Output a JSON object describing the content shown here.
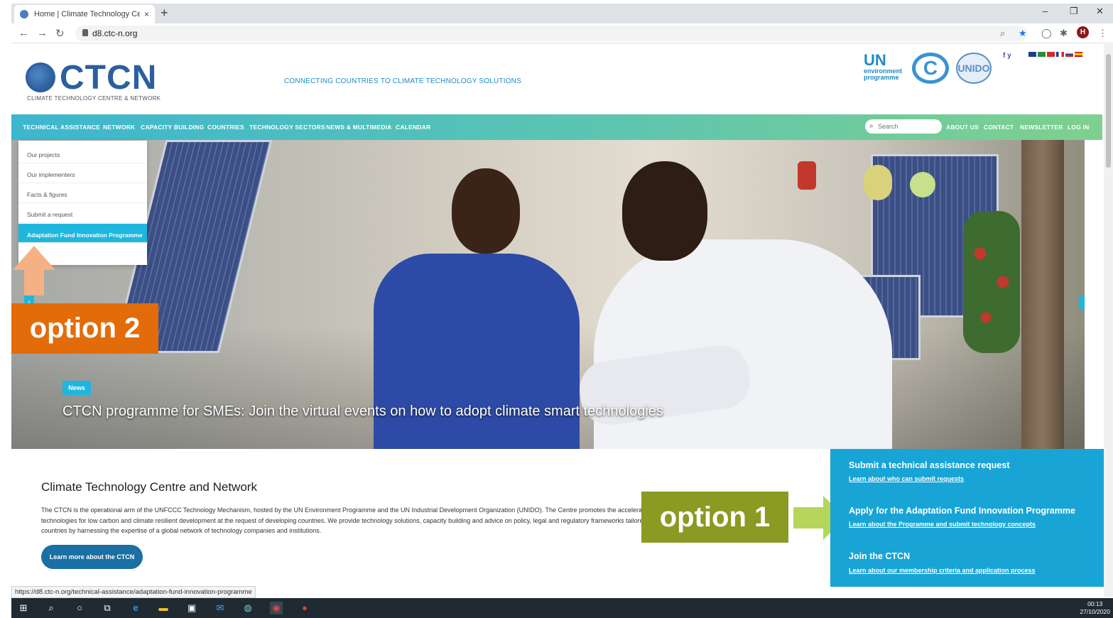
{
  "browser": {
    "tab_title": "Home | Climate Technology Cent",
    "tab_close": "×",
    "new_tab": "+",
    "url": "d8.ctc-n.org",
    "win_minimize": "–",
    "win_restore": "❐",
    "win_close": "✕",
    "avatar_letter": "H",
    "status_url": "https://d8.ctc-n.org/technical-assistance/adaptation-fund-innovation-programme"
  },
  "header": {
    "logo_text": "CTCN",
    "logo_subtitle": "CLIMATE TECHNOLOGY CENTRE & NETWORK",
    "tagline": "CONNECTING COUNTRIES TO CLIMATE TECHNOLOGY SOLUTIONS",
    "partner_un": "UN",
    "partner_un_sub1": "environment",
    "partner_un_sub2": "programme",
    "partner_unfccc": "C",
    "partner_unido": "UNIDO",
    "social": "f  y"
  },
  "nav": {
    "items": [
      "TECHNICAL ASSISTANCE",
      "NETWORK",
      "CAPACITY BUILDING",
      "COUNTRIES",
      "TECHNOLOGY SECTORS",
      "NEWS & MULTIMEDIA",
      "CALENDAR"
    ],
    "search_placeholder": "Search",
    "right_items": [
      "ABOUT US",
      "CONTACT",
      "NEWSLETTER",
      "LOG IN"
    ]
  },
  "dropdown": {
    "items": [
      "Our projects",
      "Our implementers",
      "Facts & figures",
      "Submit a request",
      "Adaptation Fund Innovation Programme"
    ]
  },
  "hero": {
    "badge": "News",
    "caption": "CTCN programme for SMEs: Join the virtual events on how to adopt climate smart technologies",
    "next": "›",
    "prev": "‹"
  },
  "annotations": {
    "option1": "option 1",
    "option2": "option 2"
  },
  "about": {
    "title": "Climate Technology Centre and Network",
    "line1": "The CTCN is the operational arm of the UNFCCC Technology Mechanism, hosted by the UN Environment Programme and the UN Industrial Development Organization (UNIDO). The Centre promotes the accelerated transfer of environmentally sound",
    "line2": "technologies for low carbon and climate resilient development at the request of developing countries. We provide technology solutions, capacity building and advice on policy, legal and regulatory frameworks tailored to the needs of individual",
    "line3": "countries by harnessing the expertise of a global network of technology companies and institutions.",
    "button": "Learn more about the CTCN"
  },
  "cta": {
    "h1": "Submit a technical assistance request",
    "l1": "Learn about who can submit requests",
    "h2": "Apply for the Adaptation Fund Innovation Programme",
    "l2": "Learn about the Programme and submit technology concepts",
    "h3": "Join the CTCN",
    "l3": "Learn about our membership criteria and application process"
  },
  "taskbar": {
    "time": "00:13",
    "date": "27/10/2020"
  }
}
